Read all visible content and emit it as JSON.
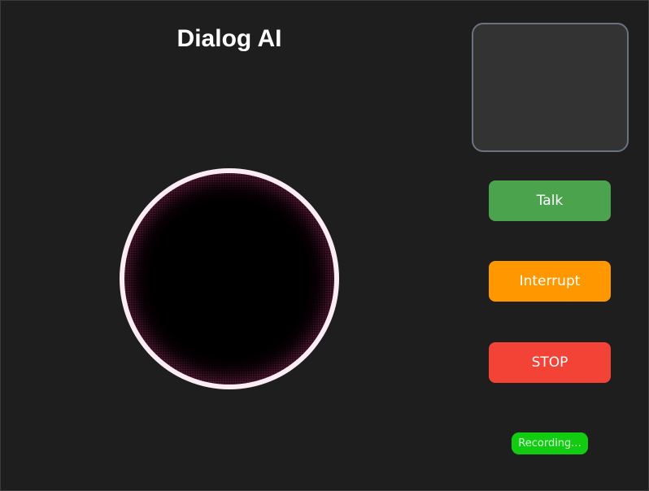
{
  "app": {
    "title": "Dialog AI"
  },
  "controls": {
    "talk_label": "Talk",
    "interrupt_label": "Interrupt",
    "stop_label": "STOP"
  },
  "status": {
    "text": "Recording..."
  },
  "colors": {
    "background": "#1e1e1e",
    "talk": "#4ba34d",
    "interrupt": "#ff9800",
    "stop": "#f34336",
    "status_badge": "#12cc12",
    "orb_ring": "#fcecf3",
    "orb_glow": "#ef5b92",
    "preview_border": "#6a7280",
    "preview_fill": "#333333"
  }
}
